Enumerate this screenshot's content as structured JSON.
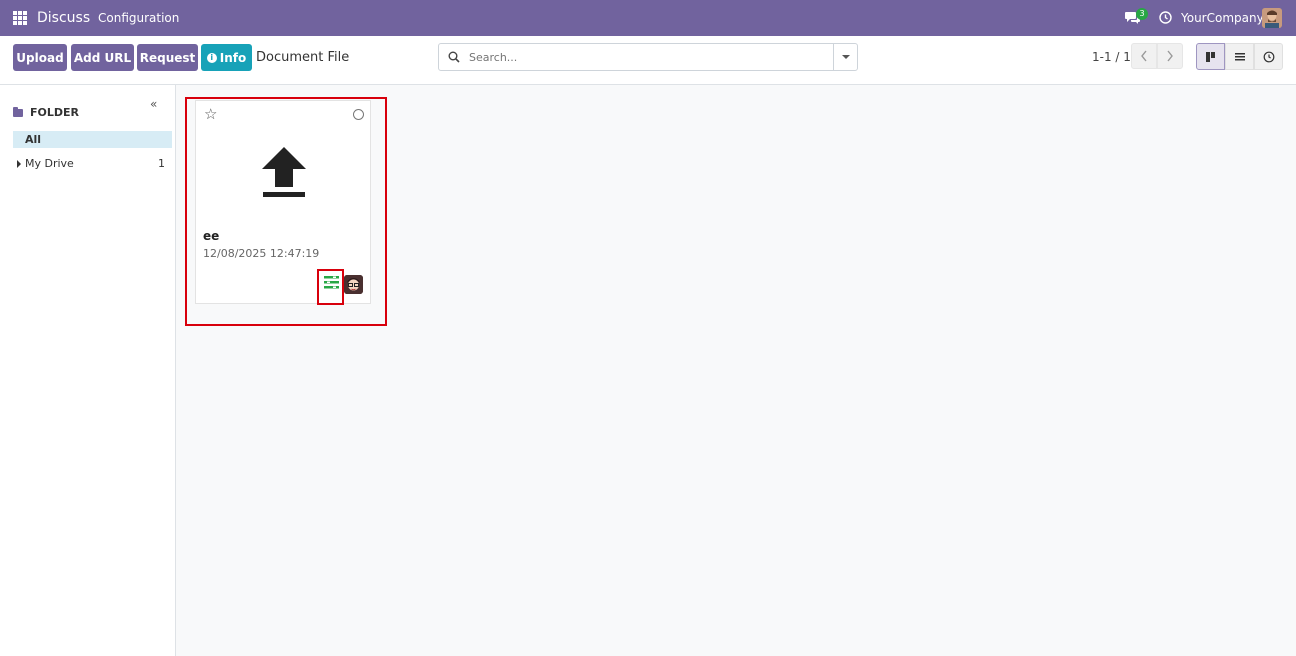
{
  "navbar": {
    "app_name": "Discuss",
    "menu_configuration": "Configuration",
    "chat_count": "3",
    "company": "YourCompany",
    "color": "#71639e"
  },
  "control": {
    "upload": "Upload",
    "add_url": "Add URL",
    "request": "Request",
    "info": "Info",
    "title": "Document File",
    "search_placeholder": "Search...",
    "pager": "1-1 / 1"
  },
  "sidebar": {
    "collapse": "«",
    "folder_label": "FOLDER",
    "items": [
      {
        "label": "All"
      },
      {
        "label": "My Drive",
        "count": "1"
      }
    ]
  },
  "card": {
    "name": "ee",
    "date": "12/08/2025 12:47:19",
    "icon": "upload-icon",
    "activity_color": "#28a745"
  }
}
